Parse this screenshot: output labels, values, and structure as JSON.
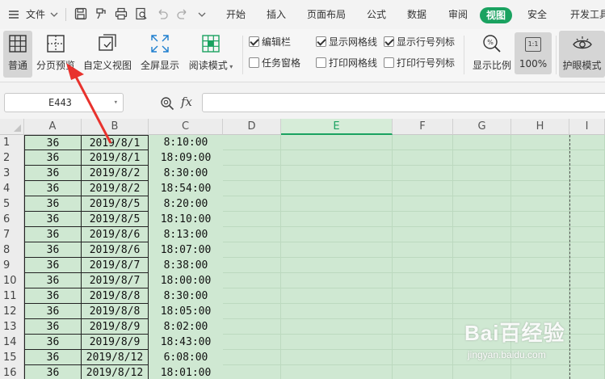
{
  "menubar": {
    "file_label": "文件",
    "tabs": [
      "开始",
      "插入",
      "页面布局",
      "公式",
      "数据",
      "审阅",
      "视图",
      "安全",
      "开发工具"
    ],
    "active_tab": "视图",
    "accent": "#1aa260"
  },
  "ribbon": {
    "normal_label": "普通",
    "page_break_label": "分页预览",
    "custom_view_label": "自定义视图",
    "fullscreen_label": "全屏显示",
    "reading_mode_label": "阅读模式",
    "checkboxes": {
      "formula_bar": {
        "label": "编辑栏",
        "checked": true
      },
      "task_pane": {
        "label": "任务窗格",
        "checked": false
      },
      "show_gridlines": {
        "label": "显示网格线",
        "checked": true
      },
      "print_gridlines": {
        "label": "打印网格线",
        "checked": false
      },
      "show_headings": {
        "label": "显示行号列标",
        "checked": true
      },
      "print_headings": {
        "label": "打印行号列标",
        "checked": false
      }
    },
    "zoom_label": "显示比例",
    "ratio_icon_text": "1:1",
    "ratio_label": "100%",
    "eye_label": "护眼模式"
  },
  "formula_bar": {
    "cell_ref": "E443",
    "fx_label": "fx",
    "value": ""
  },
  "grid": {
    "columns": [
      "A",
      "B",
      "C",
      "D",
      "E",
      "F",
      "G",
      "H",
      "I"
    ],
    "selected_column": "E",
    "rows": [
      {
        "n": "1",
        "a": "36",
        "b": "2019/8/1",
        "c": "8:10:00"
      },
      {
        "n": "2",
        "a": "36",
        "b": "2019/8/1",
        "c": "18:09:00"
      },
      {
        "n": "3",
        "a": "36",
        "b": "2019/8/2",
        "c": "8:30:00"
      },
      {
        "n": "4",
        "a": "36",
        "b": "2019/8/2",
        "c": "18:54:00"
      },
      {
        "n": "5",
        "a": "36",
        "b": "2019/8/5",
        "c": "8:20:00"
      },
      {
        "n": "6",
        "a": "36",
        "b": "2019/8/5",
        "c": "18:10:00"
      },
      {
        "n": "7",
        "a": "36",
        "b": "2019/8/6",
        "c": "8:13:00"
      },
      {
        "n": "8",
        "a": "36",
        "b": "2019/8/6",
        "c": "18:07:00"
      },
      {
        "n": "9",
        "a": "36",
        "b": "2019/8/7",
        "c": "8:38:00"
      },
      {
        "n": "10",
        "a": "36",
        "b": "2019/8/7",
        "c": "18:00:00"
      },
      {
        "n": "11",
        "a": "36",
        "b": "2019/8/8",
        "c": "8:30:00"
      },
      {
        "n": "12",
        "a": "36",
        "b": "2019/8/8",
        "c": "18:05:00"
      },
      {
        "n": "13",
        "a": "36",
        "b": "2019/8/9",
        "c": "8:02:00"
      },
      {
        "n": "14",
        "a": "36",
        "b": "2019/8/9",
        "c": "18:43:00"
      },
      {
        "n": "15",
        "a": "36",
        "b": "2019/8/12",
        "c": "6:08:00"
      },
      {
        "n": "16",
        "a": "36",
        "b": "2019/8/12",
        "c": "18:01:00"
      }
    ]
  },
  "watermark": {
    "brand": "Bai百经验",
    "url": "jingyan.baidu.com"
  }
}
